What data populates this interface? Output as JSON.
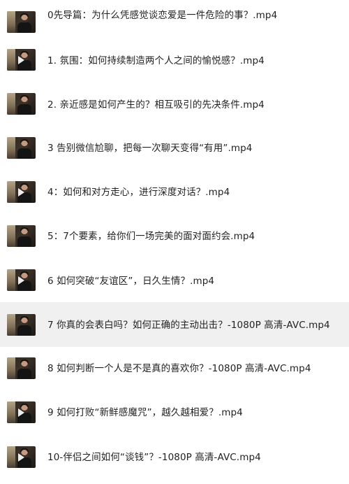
{
  "files": [
    {
      "name": "0先导篇：为什么凭感觉谈恋爱是一件危险的事？.mp4",
      "icon": "video-thumbnail-icon",
      "selected": false
    },
    {
      "name": "1. 氛围：如何持续制造两个人之间的愉悦感？.mp4",
      "icon": "video-thumbnail-icon",
      "selected": false
    },
    {
      "name": "2. 亲近感是如何产生的？相互吸引的先决条件.mp4",
      "icon": "video-thumbnail-icon",
      "selected": false
    },
    {
      "name": "3 告别微信尬聊，把每一次聊天变得“有用”.mp4",
      "icon": "video-thumbnail-icon",
      "selected": false
    },
    {
      "name": "4：如何和对方走心，进行深度对话？.mp4",
      "icon": "video-thumbnail-icon",
      "selected": false
    },
    {
      "name": "5：7个要素，给你们一场完美的面对面约会.mp4",
      "icon": "video-thumbnail-icon",
      "selected": false
    },
    {
      "name": "6 如何突破“友谊区”，日久生情？.mp4",
      "icon": "video-thumbnail-icon",
      "selected": false
    },
    {
      "name": "7 你真的会表白吗？如何正确的主动出击？-1080P 高清-AVC.mp4",
      "icon": "video-thumbnail-icon",
      "selected": true
    },
    {
      "name": "8 如何判断一个人是不是真的喜欢你？-1080P 高清-AVC.mp4",
      "icon": "video-thumbnail-icon",
      "selected": false
    },
    {
      "name": "9 如何打败“新鲜感魔咒”，越久越相爱？.mp4",
      "icon": "video-thumbnail-icon",
      "selected": false
    },
    {
      "name": "10-伴侣之间如何“谈钱”？-1080P 高清-AVC.mp4",
      "icon": "video-thumbnail-icon",
      "selected": false
    }
  ],
  "colors": {
    "background": "#ffffff",
    "selected_row": "#f0f0f0",
    "text": "#222222"
  }
}
